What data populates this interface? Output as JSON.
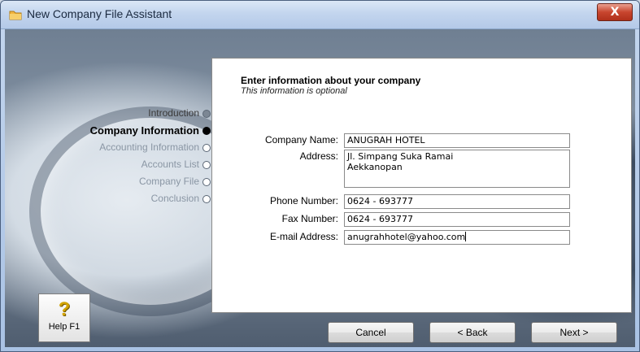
{
  "window": {
    "title": "New Company File Assistant",
    "close_label": "X"
  },
  "steps": [
    {
      "label": "Introduction",
      "state": "done"
    },
    {
      "label": "Company Information",
      "state": "current"
    },
    {
      "label": "Accounting Information",
      "state": "pending"
    },
    {
      "label": "Accounts List",
      "state": "pending"
    },
    {
      "label": "Company File",
      "state": "pending"
    },
    {
      "label": "Conclusion",
      "state": "pending"
    }
  ],
  "form": {
    "heading": "Enter information about your company",
    "subheading": "This information is optional",
    "company_name": {
      "label": "Company Name:",
      "value": "ANUGRAH HOTEL"
    },
    "address": {
      "label": "Address:",
      "line1": "Jl. Simpang Suka Ramai",
      "line2": "Aekkanopan"
    },
    "phone": {
      "label": "Phone Number:",
      "value": "0624 - 693777"
    },
    "fax": {
      "label": "Fax Number:",
      "value": "0624 - 693777"
    },
    "email": {
      "label": "E-mail Address:",
      "value": "anugrahhotel@yahoo.com"
    }
  },
  "buttons": {
    "help": "Help F1",
    "cancel": "Cancel",
    "back": "< Back",
    "next": "Next >"
  },
  "icons": {
    "app": "folder-icon",
    "help": "question-mark-icon"
  },
  "colors": {
    "step_current": "#000000",
    "step_pending": "#8a96a4"
  }
}
